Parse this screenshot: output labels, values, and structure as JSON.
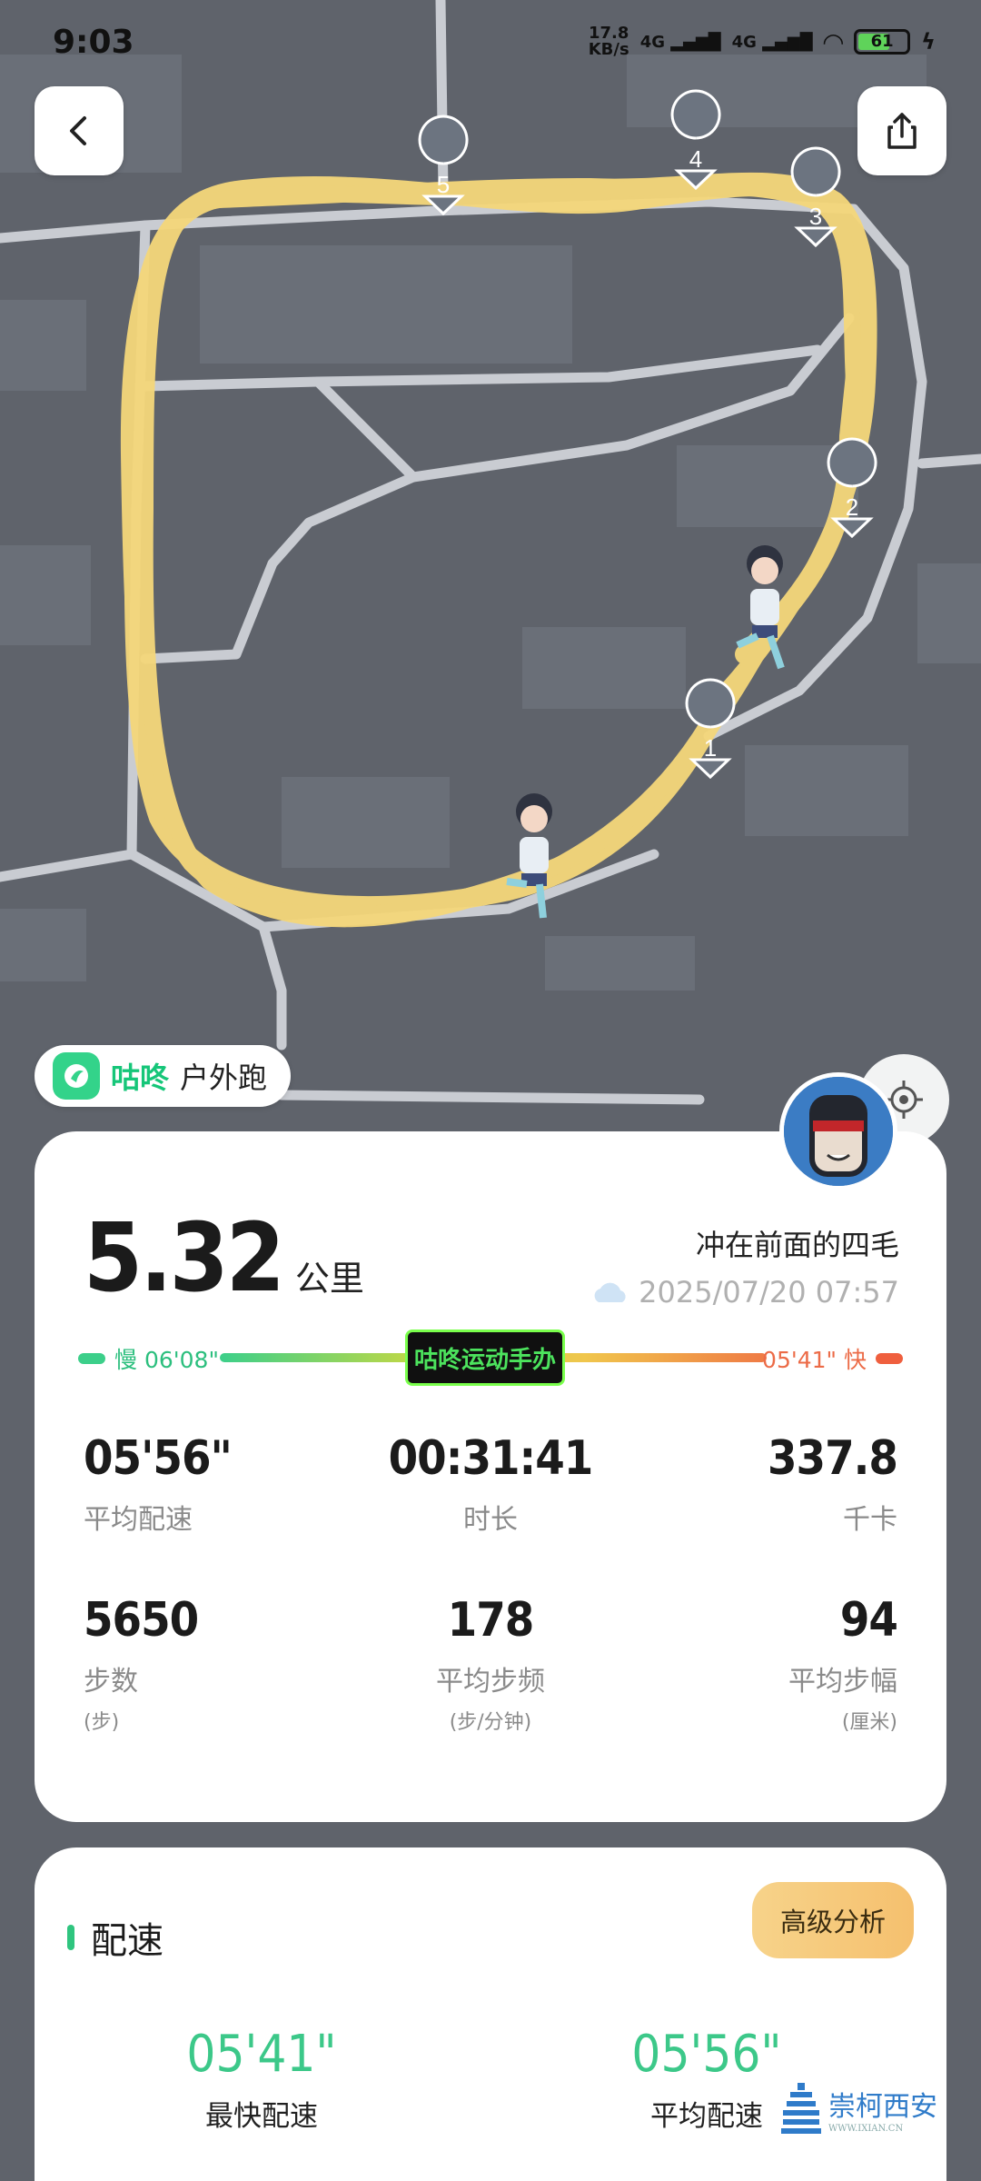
{
  "status_bar": {
    "time": "9:03",
    "net_speed_value": "17.8",
    "net_speed_unit": "KB/s",
    "signal1": "4G",
    "signal2": "4G",
    "battery": "61"
  },
  "map": {
    "lap_markers": [
      "1",
      "2",
      "3",
      "4",
      "5"
    ],
    "route_color": "#f5d77a"
  },
  "sport_badge": {
    "app_name": "咕咚",
    "sport_type": "户外跑"
  },
  "summary": {
    "distance": "5.32",
    "distance_unit": "公里",
    "username": "冲在前面的四毛",
    "datetime": "2025/07/20 07:57",
    "pace_slow": "慢 06'08\"",
    "pace_fast": "05'41\" 快",
    "ai_logo_text": "咕咚运动手办",
    "stats": [
      {
        "value": "05'56\"",
        "label": "平均配速",
        "unit": ""
      },
      {
        "value": "00:31:41",
        "label": "时长",
        "unit": ""
      },
      {
        "value": "337.8",
        "label": "千卡",
        "unit": ""
      },
      {
        "value": "5650",
        "label": "步数",
        "unit": "(步)"
      },
      {
        "value": "178",
        "label": "平均步频",
        "unit": "(步/分钟)"
      },
      {
        "value": "94",
        "label": "平均步幅",
        "unit": "(厘米)"
      }
    ]
  },
  "pace_card": {
    "title": "配速",
    "analysis_button": "高级分析",
    "fastest_value": "05'41\"",
    "fastest_label": "最快配速",
    "average_value": "05'56\"",
    "average_label": "平均配速"
  },
  "watermark": {
    "text": "崇柯西安",
    "url": "WWW.IXIAN.CN"
  }
}
